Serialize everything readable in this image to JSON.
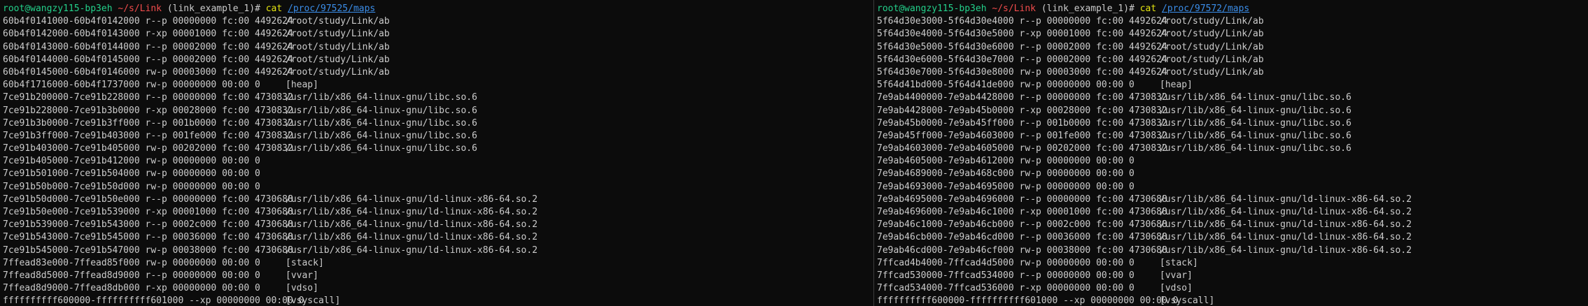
{
  "panes": [
    {
      "prompt": {
        "user_host": "root@wangzy115-bp3eh",
        "dir": "~/s/Link",
        "env": "(link_example_1)",
        "hash": "#",
        "command": "cat",
        "argument": "/proc/97525/maps"
      },
      "rows": [
        {
          "map": "60b4f0141000-60b4f0142000 r--p 00000000 fc:00 4492624",
          "path": "/root/study/Link/ab"
        },
        {
          "map": "60b4f0142000-60b4f0143000 r-xp 00001000 fc:00 4492624",
          "path": "/root/study/Link/ab"
        },
        {
          "map": "60b4f0143000-60b4f0144000 r--p 00002000 fc:00 4492624",
          "path": "/root/study/Link/ab"
        },
        {
          "map": "60b4f0144000-60b4f0145000 r--p 00002000 fc:00 4492624",
          "path": "/root/study/Link/ab"
        },
        {
          "map": "60b4f0145000-60b4f0146000 rw-p 00003000 fc:00 4492624",
          "path": "/root/study/Link/ab"
        },
        {
          "map": "60b4f1716000-60b4f1737000 rw-p 00000000 00:00 0",
          "path": "[heap]"
        },
        {
          "map": "7ce91b200000-7ce91b228000 r--p 00000000 fc:00 4730832",
          "path": "/usr/lib/x86_64-linux-gnu/libc.so.6"
        },
        {
          "map": "7ce91b228000-7ce91b3b0000 r-xp 00028000 fc:00 4730832",
          "path": "/usr/lib/x86_64-linux-gnu/libc.so.6"
        },
        {
          "map": "7ce91b3b0000-7ce91b3ff000 r--p 001b0000 fc:00 4730832",
          "path": "/usr/lib/x86_64-linux-gnu/libc.so.6"
        },
        {
          "map": "7ce91b3ff000-7ce91b403000 r--p 001fe000 fc:00 4730832",
          "path": "/usr/lib/x86_64-linux-gnu/libc.so.6"
        },
        {
          "map": "7ce91b403000-7ce91b405000 rw-p 00202000 fc:00 4730832",
          "path": "/usr/lib/x86_64-linux-gnu/libc.so.6"
        },
        {
          "map": "7ce91b405000-7ce91b412000 rw-p 00000000 00:00 0",
          "path": ""
        },
        {
          "map": "7ce91b501000-7ce91b504000 rw-p 00000000 00:00 0",
          "path": ""
        },
        {
          "map": "7ce91b50b000-7ce91b50d000 rw-p 00000000 00:00 0",
          "path": ""
        },
        {
          "map": "7ce91b50d000-7ce91b50e000 r--p 00000000 fc:00 4730688",
          "path": "/usr/lib/x86_64-linux-gnu/ld-linux-x86-64.so.2"
        },
        {
          "map": "7ce91b50e000-7ce91b539000 r-xp 00001000 fc:00 4730688",
          "path": "/usr/lib/x86_64-linux-gnu/ld-linux-x86-64.so.2"
        },
        {
          "map": "7ce91b539000-7ce91b543000 r--p 0002c000 fc:00 4730688",
          "path": "/usr/lib/x86_64-linux-gnu/ld-linux-x86-64.so.2"
        },
        {
          "map": "7ce91b543000-7ce91b545000 r--p 00036000 fc:00 4730688",
          "path": "/usr/lib/x86_64-linux-gnu/ld-linux-x86-64.so.2"
        },
        {
          "map": "7ce91b545000-7ce91b547000 rw-p 00038000 fc:00 4730688",
          "path": "/usr/lib/x86_64-linux-gnu/ld-linux-x86-64.so.2"
        },
        {
          "map": "7ffead83e000-7ffead85f000 rw-p 00000000 00:00 0",
          "path": "[stack]"
        },
        {
          "map": "7ffead8d5000-7ffead8d9000 r--p 00000000 00:00 0",
          "path": "[vvar]"
        },
        {
          "map": "7ffead8d9000-7ffead8db000 r-xp 00000000 00:00 0",
          "path": "[vdso]"
        },
        {
          "map": "ffffffffff600000-ffffffffff601000 --xp 00000000 00:00 0",
          "path": "[vsyscall]"
        }
      ]
    },
    {
      "prompt": {
        "user_host": "root@wangzy115-bp3eh",
        "dir": "~/s/Link",
        "env": "(link_example_1)",
        "hash": "#",
        "command": "cat",
        "argument": "/proc/97572/maps"
      },
      "rows": [
        {
          "map": "5f64d30e3000-5f64d30e4000 r--p 00000000 fc:00 4492624",
          "path": "/root/study/Link/ab"
        },
        {
          "map": "5f64d30e4000-5f64d30e5000 r-xp 00001000 fc:00 4492624",
          "path": "/root/study/Link/ab"
        },
        {
          "map": "5f64d30e5000-5f64d30e6000 r--p 00002000 fc:00 4492624",
          "path": "/root/study/Link/ab"
        },
        {
          "map": "5f64d30e6000-5f64d30e7000 r--p 00002000 fc:00 4492624",
          "path": "/root/study/Link/ab"
        },
        {
          "map": "5f64d30e7000-5f64d30e8000 rw-p 00003000 fc:00 4492624",
          "path": "/root/study/Link/ab"
        },
        {
          "map": "5f64d41bd000-5f64d41de000 rw-p 00000000 00:00 0",
          "path": "[heap]"
        },
        {
          "map": "7e9ab4400000-7e9ab4428000 r--p 00000000 fc:00 4730832",
          "path": "/usr/lib/x86_64-linux-gnu/libc.so.6"
        },
        {
          "map": "7e9ab4428000-7e9ab45b0000 r-xp 00028000 fc:00 4730832",
          "path": "/usr/lib/x86_64-linux-gnu/libc.so.6"
        },
        {
          "map": "7e9ab45b0000-7e9ab45ff000 r--p 001b0000 fc:00 4730832",
          "path": "/usr/lib/x86_64-linux-gnu/libc.so.6"
        },
        {
          "map": "7e9ab45ff000-7e9ab4603000 r--p 001fe000 fc:00 4730832",
          "path": "/usr/lib/x86_64-linux-gnu/libc.so.6"
        },
        {
          "map": "7e9ab4603000-7e9ab4605000 rw-p 00202000 fc:00 4730832",
          "path": "/usr/lib/x86_64-linux-gnu/libc.so.6"
        },
        {
          "map": "7e9ab4605000-7e9ab4612000 rw-p 00000000 00:00 0",
          "path": ""
        },
        {
          "map": "7e9ab4689000-7e9ab468c000 rw-p 00000000 00:00 0",
          "path": ""
        },
        {
          "map": "7e9ab4693000-7e9ab4695000 rw-p 00000000 00:00 0",
          "path": ""
        },
        {
          "map": "7e9ab4695000-7e9ab4696000 r--p 00000000 fc:00 4730688",
          "path": "/usr/lib/x86_64-linux-gnu/ld-linux-x86-64.so.2"
        },
        {
          "map": "7e9ab4696000-7e9ab46c1000 r-xp 00001000 fc:00 4730688",
          "path": "/usr/lib/x86_64-linux-gnu/ld-linux-x86-64.so.2"
        },
        {
          "map": "7e9ab46c1000-7e9ab46cb000 r--p 0002c000 fc:00 4730688",
          "path": "/usr/lib/x86_64-linux-gnu/ld-linux-x86-64.so.2"
        },
        {
          "map": "7e9ab46cb000-7e9ab46cd000 r--p 00036000 fc:00 4730688",
          "path": "/usr/lib/x86_64-linux-gnu/ld-linux-x86-64.so.2"
        },
        {
          "map": "7e9ab46cd000-7e9ab46cf000 rw-p 00038000 fc:00 4730688",
          "path": "/usr/lib/x86_64-linux-gnu/ld-linux-x86-64.so.2"
        },
        {
          "map": "7ffcad4b4000-7ffcad4d5000 rw-p 00000000 00:00 0",
          "path": "[stack]"
        },
        {
          "map": "7ffcad530000-7ffcad534000 r--p 00000000 00:00 0",
          "path": "[vvar]"
        },
        {
          "map": "7ffcad534000-7ffcad536000 r-xp 00000000 00:00 0",
          "path": "[vdso]"
        },
        {
          "map": "ffffffffff600000-ffffffffff601000 --xp 00000000 00:00 0",
          "path": "[vsyscall]"
        }
      ]
    }
  ]
}
